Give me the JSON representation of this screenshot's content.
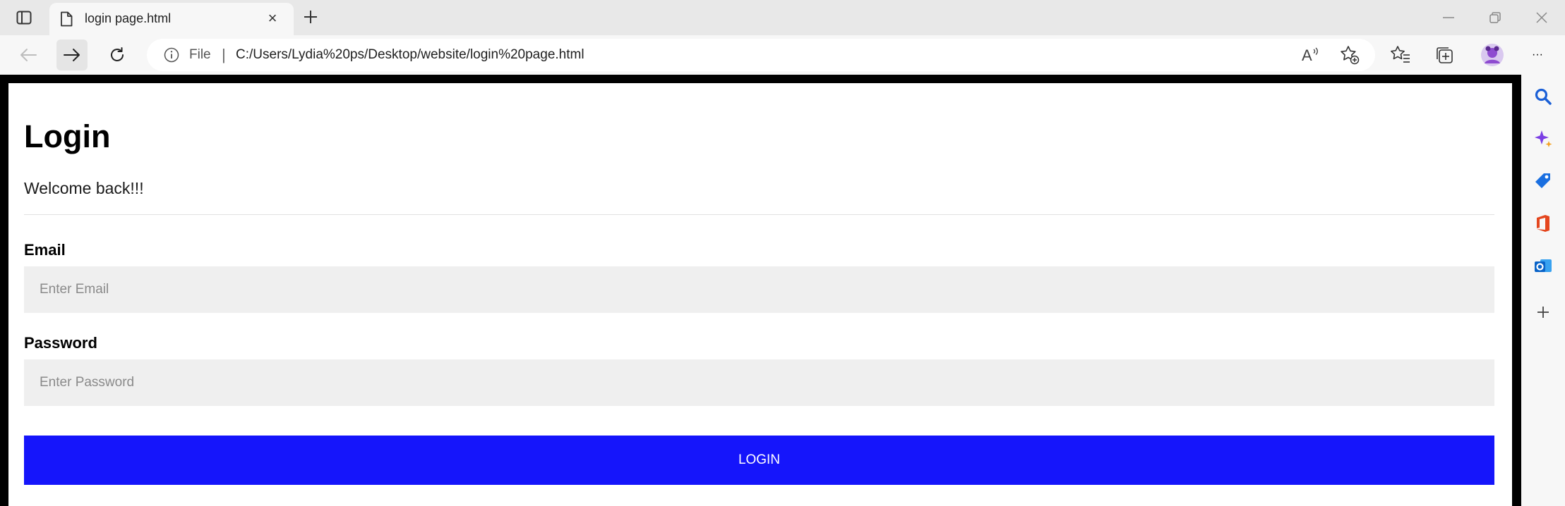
{
  "browser": {
    "tab": {
      "title": "login page.html",
      "close_glyph": "×"
    },
    "address": {
      "scheme_label": "File",
      "separator": "|",
      "url": "C:/Users/Lydia%20ps/Desktop/website/login%20page.html"
    },
    "icons": {
      "sidebar_toggle": "tab-actions-icon",
      "page": "page-icon",
      "new_tab": "plus-icon",
      "back": "back-arrow-icon",
      "forward": "forward-arrow-icon",
      "refresh": "refresh-icon",
      "info": "info-icon",
      "read_aloud": "read-aloud-icon",
      "add_favorite": "add-favorite-icon",
      "favorites": "favorites-icon",
      "collections": "collections-icon",
      "profile": "profile-icon",
      "more": "more-icon"
    },
    "more_glyph": "···",
    "read_aloud_glyph": "A"
  },
  "page": {
    "title": "Login",
    "subtitle": "Welcome back!!!",
    "email": {
      "label": "Email",
      "placeholder": "Enter Email",
      "value": ""
    },
    "password": {
      "label": "Password",
      "placeholder": "Enter Password",
      "value": ""
    },
    "submit_label": "LOGIN"
  },
  "edge_sidebar": {
    "items": [
      "search-icon",
      "copilot-icon",
      "shopping-icon",
      "office-icon",
      "outlook-icon",
      "add-icon"
    ]
  },
  "colors": {
    "accent_button": "#1515fb",
    "input_background": "#efefef",
    "chrome_background": "#e8e8e8",
    "viewport_frame": "#000000"
  }
}
